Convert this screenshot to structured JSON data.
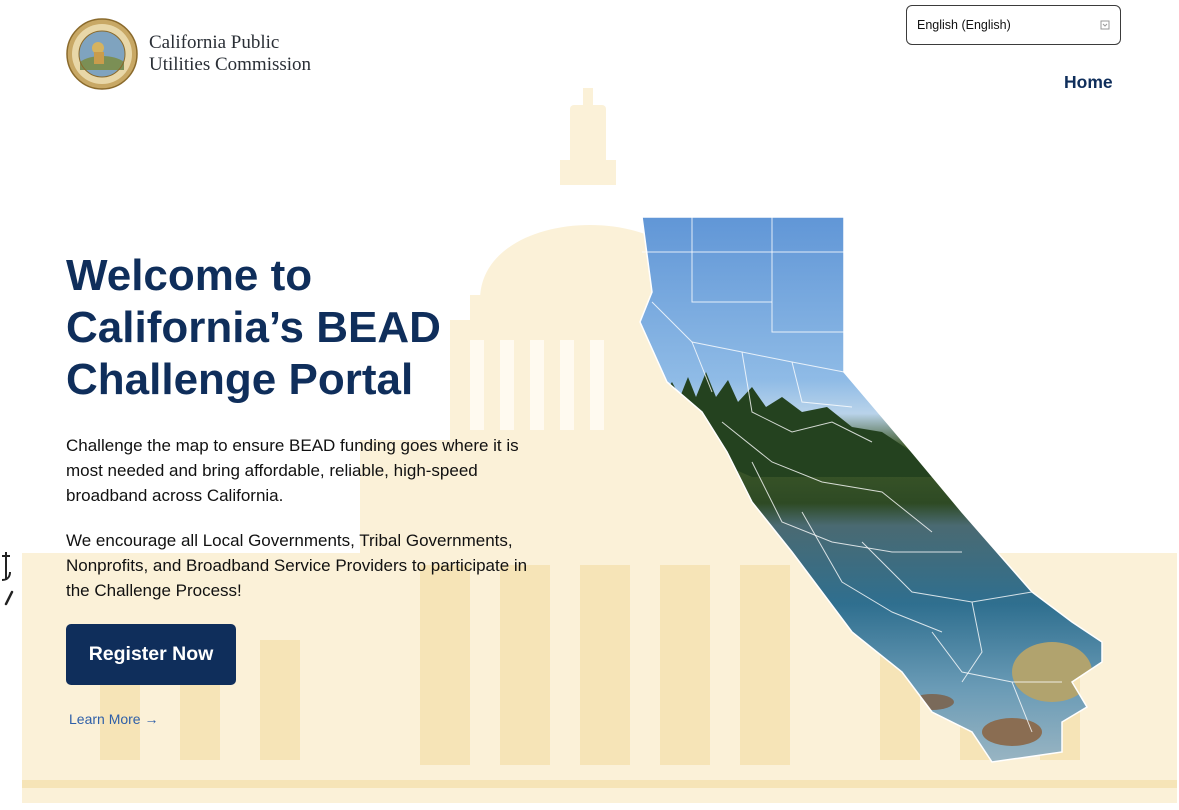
{
  "header": {
    "org_name_line1": "California Public",
    "org_name_line2": "Utilities Commission",
    "seal_text_top": "PUBLIC UTILITIES COMMISSION",
    "seal_text_bottom": "STATE OF CALIFORNIA",
    "language": {
      "selected": "English (English)"
    },
    "nav": {
      "home_label": "Home"
    }
  },
  "hero": {
    "title_line1": "Welcome to",
    "title_line2": "California’s BEAD",
    "title_line3": "Challenge Portal",
    "paragraph1_line1": "Challenge the map to ensure BEAD funding goes where it is",
    "paragraph1_line2": "most needed and bring affordable, reliable, high-speed",
    "paragraph1_line3": "broadband across California.",
    "paragraph2_line1": "We encourage all Local Governments, Tribal Governments,",
    "paragraph2_line2": "Nonprofits, and Broadband Service Providers to participate in",
    "paragraph2_line3": "the Challenge Process!",
    "register_label": "Register Now",
    "learn_more_label": "Learn More →"
  },
  "colors": {
    "brand_navy": "#0f2e5b",
    "link_blue": "#2e5fa8",
    "capitol_tint": "#fbf1d8"
  },
  "icons": {
    "seal": "cpuc-seal-icon",
    "language_caret": "dropdown-icon",
    "learn_more_arrow": "arrow-right-icon",
    "map": "california-map-icon"
  }
}
